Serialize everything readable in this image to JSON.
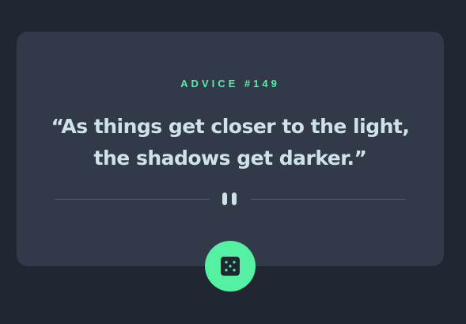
{
  "advice": {
    "label": "ADVICE #149",
    "quote": "“As things get closer to the light, the shadows get darker.”"
  },
  "icons": {
    "divider": "pause-icon",
    "button": "dice-icon"
  },
  "colors": {
    "background": "#202632",
    "card": "#323a49",
    "accent": "#53f1a1",
    "quote_text": "#cee3e9",
    "divider_line": "#4f5d74"
  }
}
